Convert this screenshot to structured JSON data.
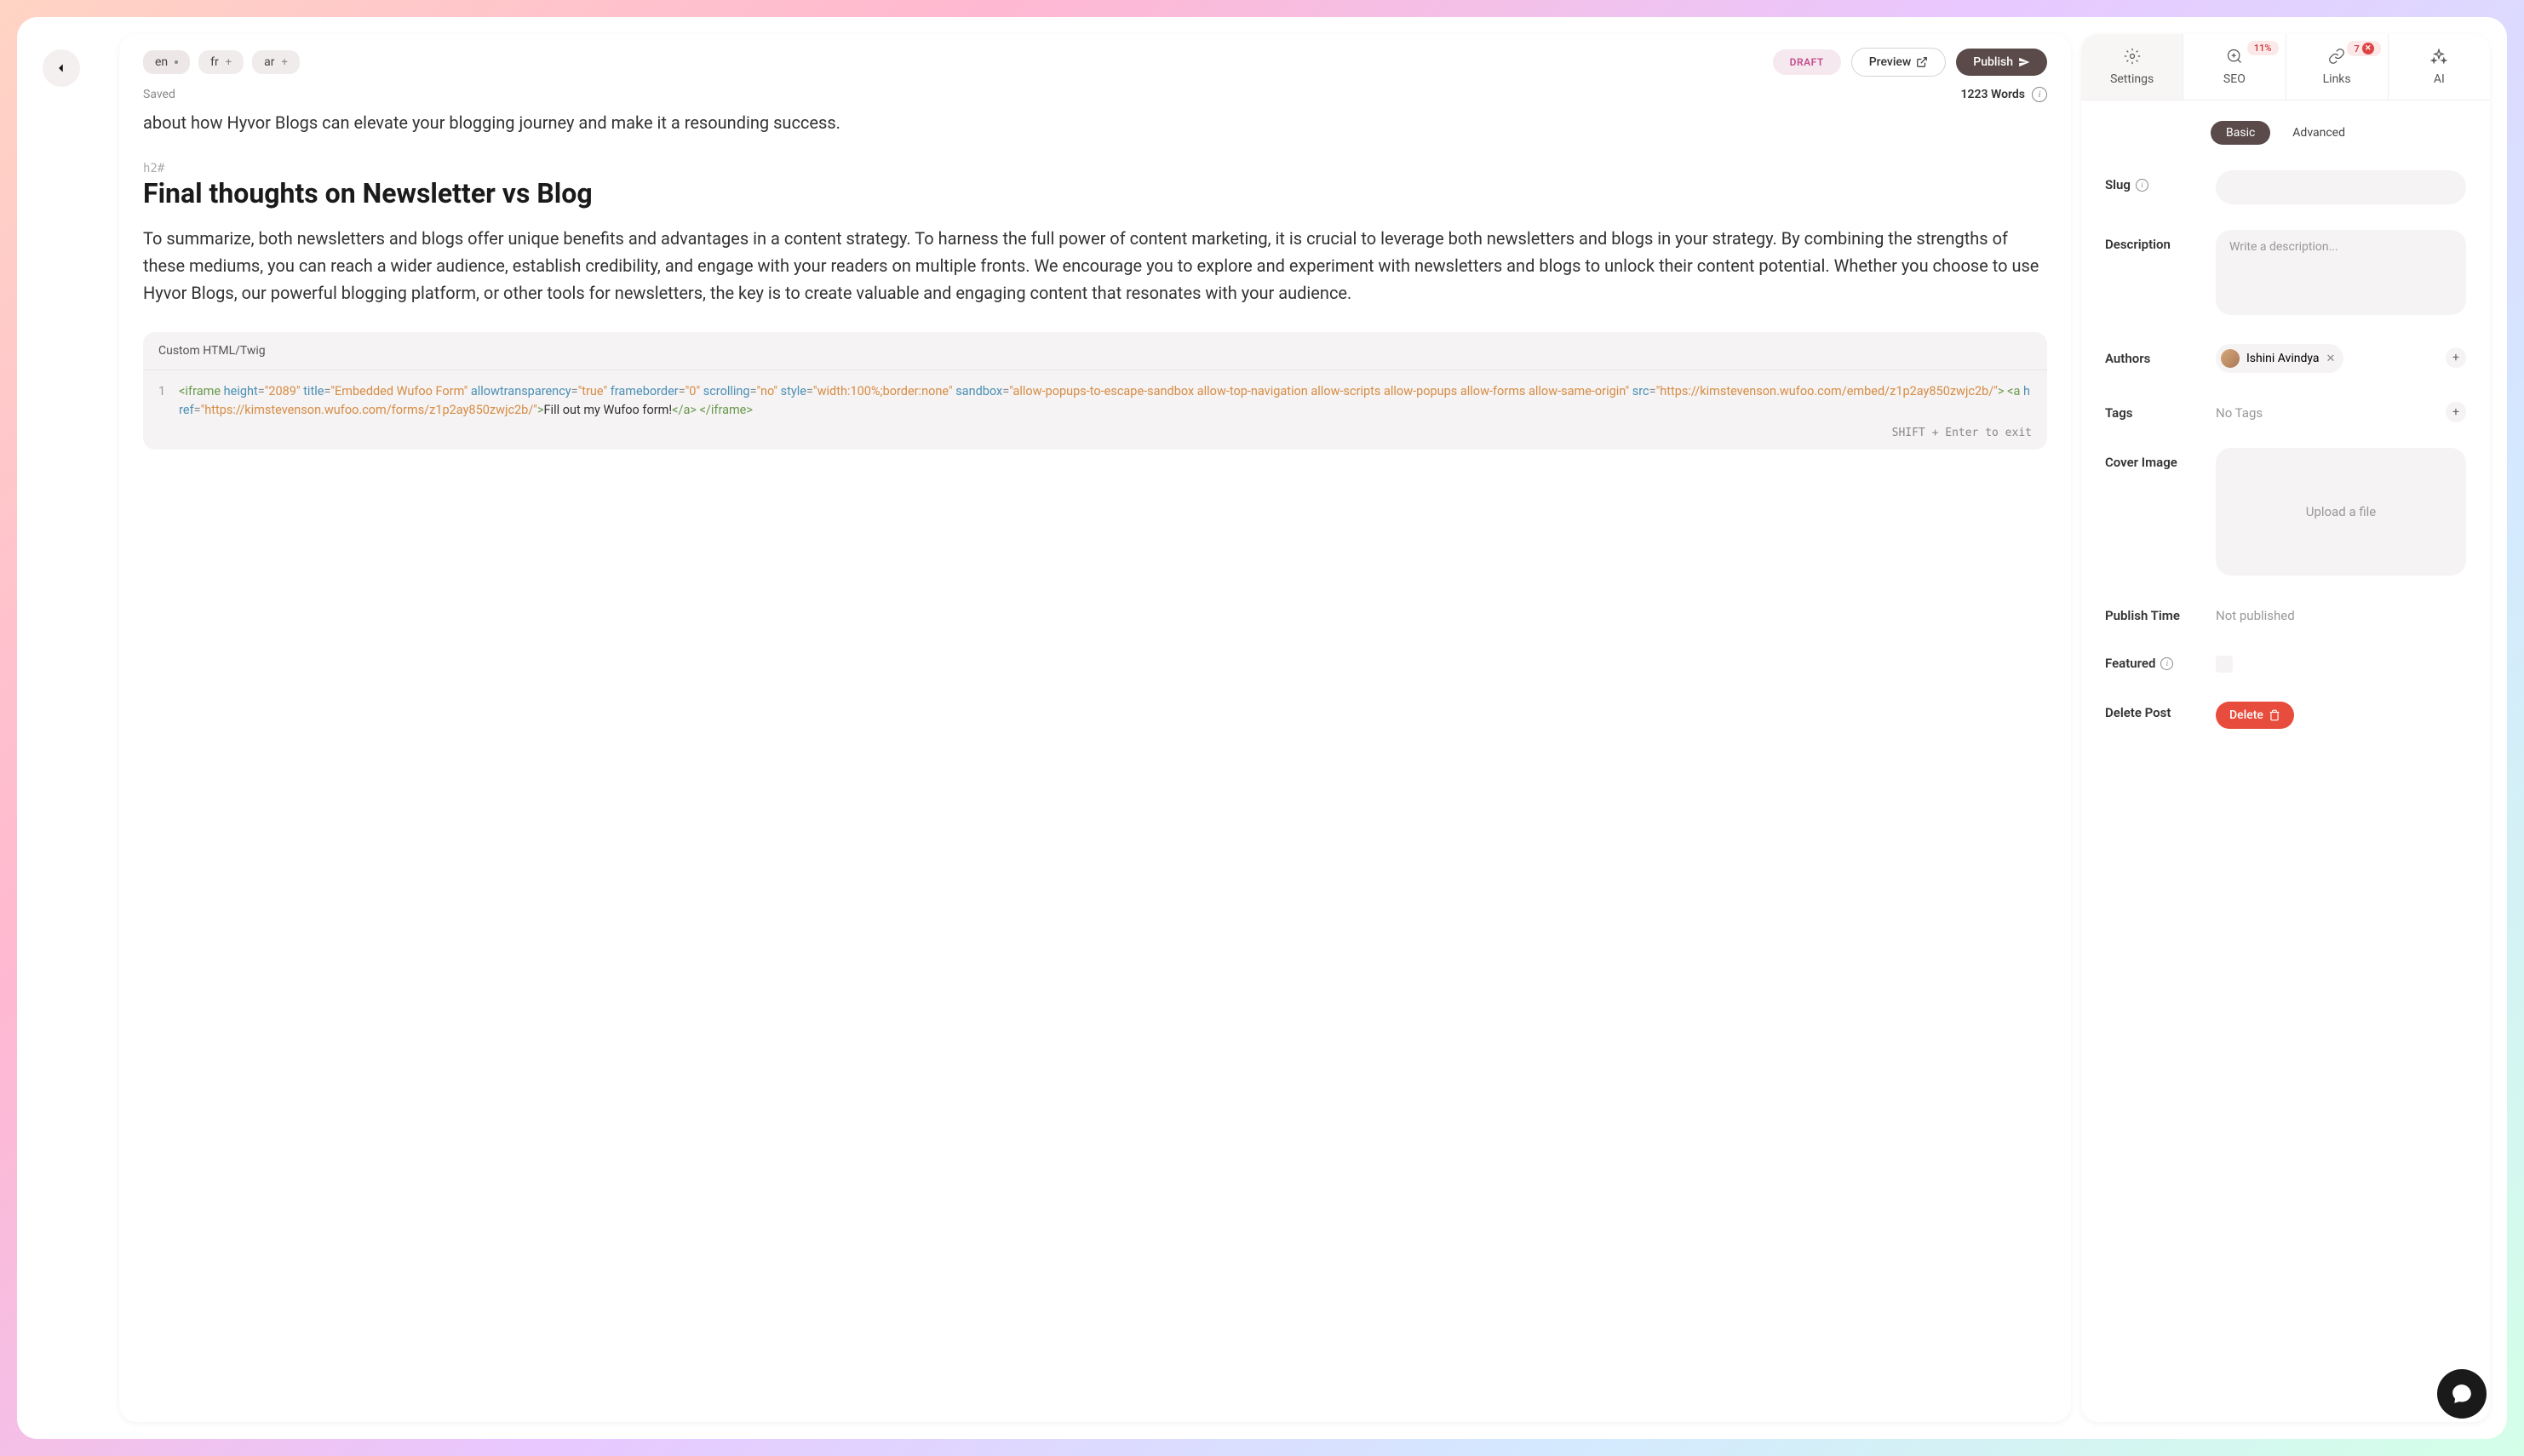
{
  "langs": {
    "primary": "en",
    "secondary": [
      "fr",
      "ar"
    ]
  },
  "header": {
    "draft": "DRAFT",
    "preview": "Preview",
    "publish": "Publish",
    "saved": "Saved",
    "wordCount": "1223 Words"
  },
  "content": {
    "intro": "about how Hyvor Blogs can elevate your blogging journey and make it a resounding success.",
    "h2Marker": "h2#",
    "heading": "Final thoughts on Newsletter vs Blog",
    "body": "To summarize, both newsletters and blogs offer unique benefits and advantages in a content strategy. To harness the full power of content marketing, it is crucial to leverage both newsletters and blogs in your strategy. By combining the strengths of these mediums, you can reach a wider audience, establish credibility, and engage with your readers on multiple fronts. We encourage you to explore and experiment with newsletters and blogs to unlock their content potential. Whether you choose to use Hyvor Blogs, our powerful blogging platform, or other tools for newsletters, the key is to create valuable and engaging content that resonates with your audience."
  },
  "codeBlock": {
    "title": "Custom HTML/Twig",
    "lineNum": "1",
    "height": "\"2089\"",
    "title_attr": "\"Embedded Wufoo Form\"",
    "allow_t": "\"true\"",
    "frameborder": "\"0\"",
    "scrolling": "\"no\"",
    "style_val": "\"width:100%;border:none\"",
    "sandbox_val": "\"allow-popups-to-escape-sandbox allow-top-navigation allow-scripts allow-popups allow-forms allow-same-origin\"",
    "src_val": "\"https://kimstevenson.wufoo.com/embed/z1p2ay850zwjc2b/\"",
    "href_val": "\"https://kimstevenson.wufoo.com/forms/z1p2ay850zwjc2b/\"",
    "link_text": "Fill out my Wufoo form!",
    "footer": "SHIFT + Enter to exit"
  },
  "sidebar": {
    "tabs": {
      "settings": "Settings",
      "seo": "SEO",
      "seoBadge": "11%",
      "links": "Links",
      "linksBadge": "7",
      "ai": "AI"
    },
    "pills": {
      "basic": "Basic",
      "advanced": "Advanced"
    },
    "fields": {
      "slug": "Slug",
      "description": "Description",
      "descPlaceholder": "Write a description...",
      "authors": "Authors",
      "authorName": "Ishini Avindya",
      "tags": "Tags",
      "noTags": "No Tags",
      "coverImage": "Cover Image",
      "uploadText": "Upload a file",
      "publishTime": "Publish Time",
      "publishTimeVal": "Not published",
      "featured": "Featured",
      "deletePost": "Delete Post",
      "deleteBtn": "Delete"
    }
  }
}
